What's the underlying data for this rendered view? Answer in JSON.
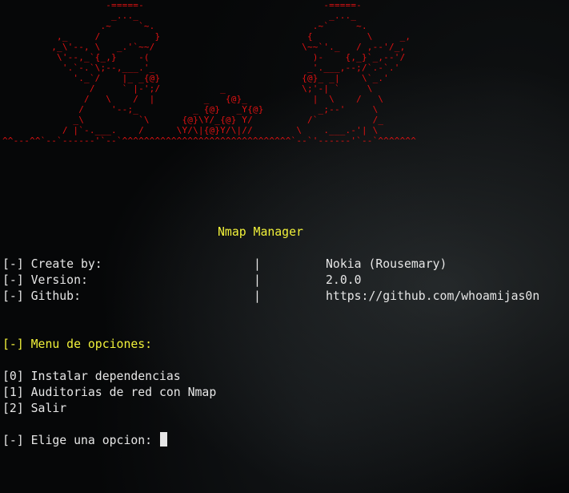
{
  "banner": {
    "art": "                   -=====-                                 -=====-\n                    _..._                                   _..._\n                  .~     `~.                             .~`     ~.\n          ,_     /          }                           {          \\     _,\n         ,_\\'--, \\   _.'`~~/                           \\~~`'._   / ,--'/_,\n          \\'--,_`{_,}    -(                              )-    {,_}`_,--'/\n           '.`-.`\\;--,___.'_                            _'.___,--;/`.-`.'\n             '._`/    |_ _{@}                          {@}_ _|    \\`_.'\n                /     ` |-';/           _              \\;'-| `     \\\n               /   \\    /  |         _   {@}_            |  \\    /   \\\n              /     '--;_          _ {@}   _Y{@}          _;--'     \\\n             _\\          `\\      {@}\\Y/_{@} Y/          /`          /_\n           / |`-.___.    /      \\Y/\\|{@}Y/\\|//        \\    .___.-'| \\\n^^---^^`--`------'`--`^^^^^^^^^^^^^^^^^^^^^^^^^^^^^^^`--`'------'`--`^^^^^^^"
  },
  "title": "Nmap Manager",
  "info": [
    {
      "label": "[-] Create by:",
      "sep": "|",
      "value": "Nokia (Rousemary)"
    },
    {
      "label": "[-] Version:",
      "sep": "|",
      "value": "2.0.0"
    },
    {
      "label": "[-] Github:",
      "sep": "|",
      "value": "https://github.com/whoamijas0n"
    }
  ],
  "menu": {
    "heading": "[-] Menu de opciones:",
    "options": [
      "[0] Instalar dependencias",
      "[1] Auditorias de red con Nmap",
      "[2] Salir"
    ]
  },
  "prompt": "[-] Elige una opcion: ",
  "colors": {
    "banner": "#e01212",
    "text": "#e6e6e6",
    "heading": "#f1f13a",
    "background": "#060708"
  }
}
